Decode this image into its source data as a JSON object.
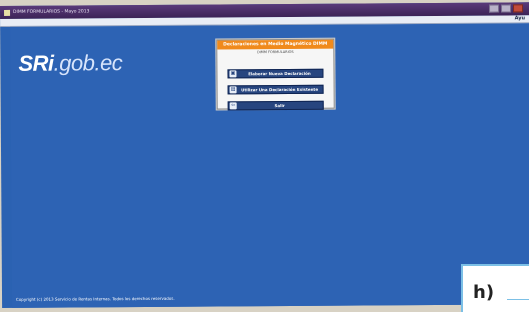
{
  "window": {
    "title": "DIMM FORMULARIOS - Mayo 2013",
    "menu_right": "Ayu"
  },
  "logo": {
    "main": "SRi",
    "sub": ".gob.ec"
  },
  "dialog": {
    "title": "Declaraciones en Medio Magnético DIMM",
    "subtitle": "DIMM FORMULARIOS",
    "buttons": {
      "new_label": "Elaborar Nueva Declaración",
      "open_label": "Utilizar Una Declaración Existente",
      "exit_label": "Salir"
    }
  },
  "footer": {
    "copyright": "Copyright (c) 2013 Servicio de Rentas Internas. Todos los derechos reservados."
  },
  "figure_label": {
    "text": "h)"
  },
  "colors": {
    "desktop": "#2d63b4",
    "dialog_title": "#f08a1c",
    "button": "#27457f"
  }
}
